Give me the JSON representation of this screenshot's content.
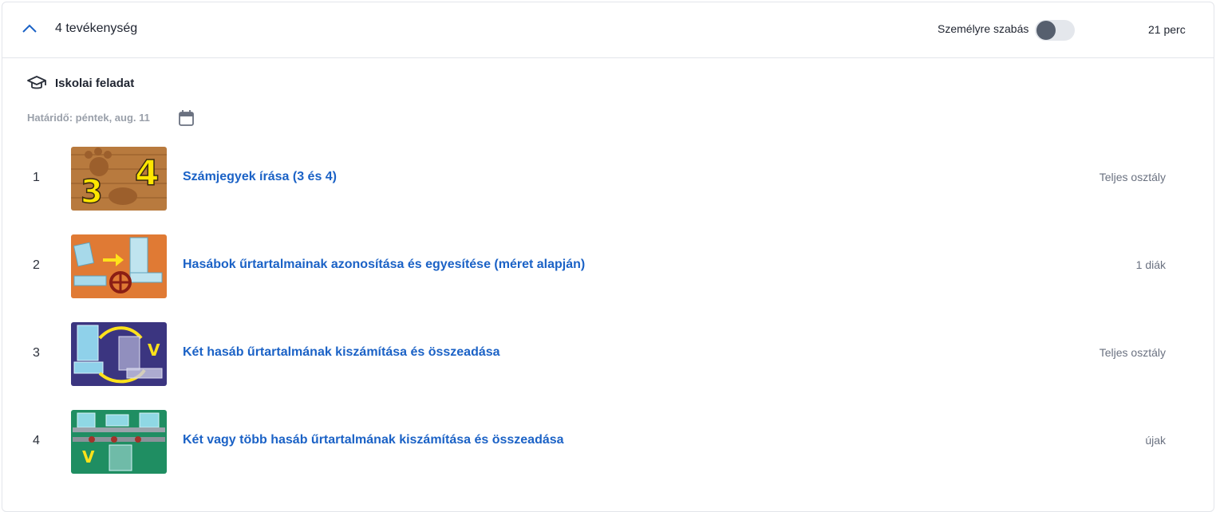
{
  "header": {
    "activity_count": "4 tevékenység",
    "customize_label": "Személyre szabás",
    "customize_enabled": false,
    "duration": "21 perc",
    "collapse_icon": "chevron-up-icon"
  },
  "section": {
    "icon": "graduation-cap-icon",
    "title": "Iskolai feladat",
    "deadline": "Határidő: péntek, aug. 11",
    "calendar_icon": "calendar-icon"
  },
  "activities": [
    {
      "number": "1",
      "title": "Számjegyek írása (3 és 4)",
      "audience": "Teljes osztály"
    },
    {
      "number": "2",
      "title": "Hasábok űrtartalmainak azonosítása és egyesítése (méret alapján)",
      "audience": "1 diák"
    },
    {
      "number": "3",
      "title": "Két hasáb űrtartalmának kiszámítása és összeadása",
      "audience": "Teljes osztály"
    },
    {
      "number": "4",
      "title": "Két vagy több hasáb űrtartalmának kiszámítása és összeadása",
      "audience": "újak"
    }
  ],
  "thumbnails": [
    {
      "digits": [
        "3",
        "4"
      ]
    },
    {},
    {
      "letter": "V"
    },
    {
      "letter": "V"
    }
  ],
  "colors": {
    "link": "#1b62c6",
    "muted": "#9aa0aa",
    "toggle_knob": "#565f6e",
    "toggle_track": "#e4e7ec"
  }
}
